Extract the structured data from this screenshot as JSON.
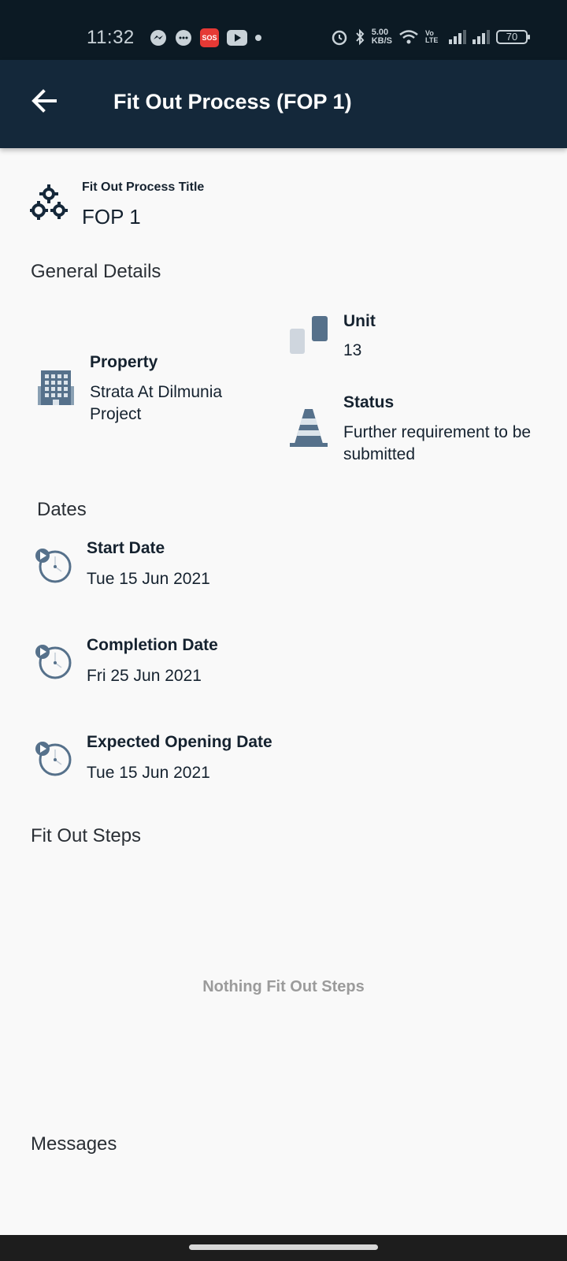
{
  "status_bar": {
    "time": "11:32",
    "notification_icons": [
      "messenger-icon",
      "message-icon",
      "sos-icon",
      "youtube-icon",
      "dot-icon"
    ],
    "net_speed": "5.00\nKB/S",
    "volte_label": "Vo LTE",
    "battery": "70"
  },
  "app_bar": {
    "title": "Fit Out Process (FOP 1)",
    "back_icon": "arrow-back-icon"
  },
  "header": {
    "label": "Fit Out Process Title",
    "value": "FOP 1",
    "icon": "gears-icon"
  },
  "general_details": {
    "heading": "General Details",
    "property": {
      "label": "Property",
      "value": "Strata At Dilmunia Project",
      "icon": "building-icon"
    },
    "unit": {
      "label": "Unit",
      "value": "13",
      "icon": "unit-blocks-icon"
    },
    "status": {
      "label": "Status",
      "value": "Further requirement to be submitted",
      "icon": "traffic-cone-icon"
    }
  },
  "dates": {
    "heading": "Dates",
    "items": [
      {
        "label": "Start Date",
        "value": "Tue 15 Jun 2021",
        "icon": "clock-play-icon"
      },
      {
        "label": "Completion Date",
        "value": "Fri 25 Jun 2021",
        "icon": "clock-play-icon"
      },
      {
        "label": "Expected Opening Date",
        "value": "Tue 15 Jun 2021",
        "icon": "clock-play-icon"
      }
    ]
  },
  "fit_out_steps": {
    "heading": "Fit Out Steps",
    "empty_message": "Nothing Fit Out Steps"
  },
  "messages": {
    "heading": "Messages"
  },
  "colors": {
    "app_bar": "#14283a",
    "status_bar": "#0c1a24",
    "icon_blue": "#56718b",
    "background": "#f9f9f9"
  }
}
